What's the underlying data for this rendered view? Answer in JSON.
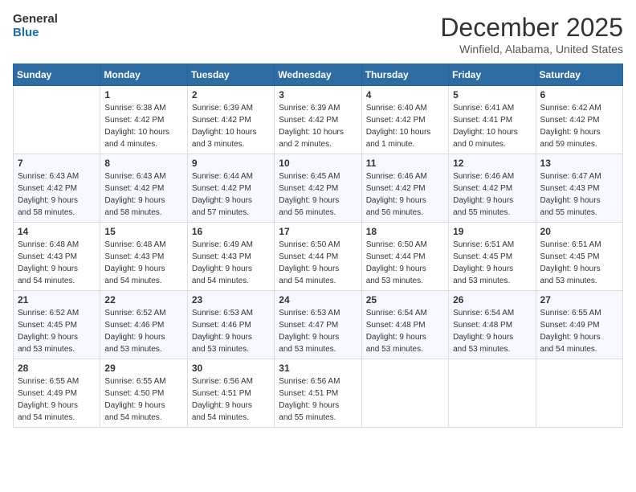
{
  "header": {
    "logo_line1": "General",
    "logo_line2": "Blue",
    "month_title": "December 2025",
    "location": "Winfield, Alabama, United States"
  },
  "weekdays": [
    "Sunday",
    "Monday",
    "Tuesday",
    "Wednesday",
    "Thursday",
    "Friday",
    "Saturday"
  ],
  "weeks": [
    [
      {
        "day": "",
        "info": ""
      },
      {
        "day": "1",
        "info": "Sunrise: 6:38 AM\nSunset: 4:42 PM\nDaylight: 10 hours\nand 4 minutes."
      },
      {
        "day": "2",
        "info": "Sunrise: 6:39 AM\nSunset: 4:42 PM\nDaylight: 10 hours\nand 3 minutes."
      },
      {
        "day": "3",
        "info": "Sunrise: 6:39 AM\nSunset: 4:42 PM\nDaylight: 10 hours\nand 2 minutes."
      },
      {
        "day": "4",
        "info": "Sunrise: 6:40 AM\nSunset: 4:42 PM\nDaylight: 10 hours\nand 1 minute."
      },
      {
        "day": "5",
        "info": "Sunrise: 6:41 AM\nSunset: 4:41 PM\nDaylight: 10 hours\nand 0 minutes."
      },
      {
        "day": "6",
        "info": "Sunrise: 6:42 AM\nSunset: 4:42 PM\nDaylight: 9 hours\nand 59 minutes."
      }
    ],
    [
      {
        "day": "7",
        "info": "Sunrise: 6:43 AM\nSunset: 4:42 PM\nDaylight: 9 hours\nand 58 minutes."
      },
      {
        "day": "8",
        "info": "Sunrise: 6:43 AM\nSunset: 4:42 PM\nDaylight: 9 hours\nand 58 minutes."
      },
      {
        "day": "9",
        "info": "Sunrise: 6:44 AM\nSunset: 4:42 PM\nDaylight: 9 hours\nand 57 minutes."
      },
      {
        "day": "10",
        "info": "Sunrise: 6:45 AM\nSunset: 4:42 PM\nDaylight: 9 hours\nand 56 minutes."
      },
      {
        "day": "11",
        "info": "Sunrise: 6:46 AM\nSunset: 4:42 PM\nDaylight: 9 hours\nand 56 minutes."
      },
      {
        "day": "12",
        "info": "Sunrise: 6:46 AM\nSunset: 4:42 PM\nDaylight: 9 hours\nand 55 minutes."
      },
      {
        "day": "13",
        "info": "Sunrise: 6:47 AM\nSunset: 4:43 PM\nDaylight: 9 hours\nand 55 minutes."
      }
    ],
    [
      {
        "day": "14",
        "info": "Sunrise: 6:48 AM\nSunset: 4:43 PM\nDaylight: 9 hours\nand 54 minutes."
      },
      {
        "day": "15",
        "info": "Sunrise: 6:48 AM\nSunset: 4:43 PM\nDaylight: 9 hours\nand 54 minutes."
      },
      {
        "day": "16",
        "info": "Sunrise: 6:49 AM\nSunset: 4:43 PM\nDaylight: 9 hours\nand 54 minutes."
      },
      {
        "day": "17",
        "info": "Sunrise: 6:50 AM\nSunset: 4:44 PM\nDaylight: 9 hours\nand 54 minutes."
      },
      {
        "day": "18",
        "info": "Sunrise: 6:50 AM\nSunset: 4:44 PM\nDaylight: 9 hours\nand 53 minutes."
      },
      {
        "day": "19",
        "info": "Sunrise: 6:51 AM\nSunset: 4:45 PM\nDaylight: 9 hours\nand 53 minutes."
      },
      {
        "day": "20",
        "info": "Sunrise: 6:51 AM\nSunset: 4:45 PM\nDaylight: 9 hours\nand 53 minutes."
      }
    ],
    [
      {
        "day": "21",
        "info": "Sunrise: 6:52 AM\nSunset: 4:45 PM\nDaylight: 9 hours\nand 53 minutes."
      },
      {
        "day": "22",
        "info": "Sunrise: 6:52 AM\nSunset: 4:46 PM\nDaylight: 9 hours\nand 53 minutes."
      },
      {
        "day": "23",
        "info": "Sunrise: 6:53 AM\nSunset: 4:46 PM\nDaylight: 9 hours\nand 53 minutes."
      },
      {
        "day": "24",
        "info": "Sunrise: 6:53 AM\nSunset: 4:47 PM\nDaylight: 9 hours\nand 53 minutes."
      },
      {
        "day": "25",
        "info": "Sunrise: 6:54 AM\nSunset: 4:48 PM\nDaylight: 9 hours\nand 53 minutes."
      },
      {
        "day": "26",
        "info": "Sunrise: 6:54 AM\nSunset: 4:48 PM\nDaylight: 9 hours\nand 53 minutes."
      },
      {
        "day": "27",
        "info": "Sunrise: 6:55 AM\nSunset: 4:49 PM\nDaylight: 9 hours\nand 54 minutes."
      }
    ],
    [
      {
        "day": "28",
        "info": "Sunrise: 6:55 AM\nSunset: 4:49 PM\nDaylight: 9 hours\nand 54 minutes."
      },
      {
        "day": "29",
        "info": "Sunrise: 6:55 AM\nSunset: 4:50 PM\nDaylight: 9 hours\nand 54 minutes."
      },
      {
        "day": "30",
        "info": "Sunrise: 6:56 AM\nSunset: 4:51 PM\nDaylight: 9 hours\nand 54 minutes."
      },
      {
        "day": "31",
        "info": "Sunrise: 6:56 AM\nSunset: 4:51 PM\nDaylight: 9 hours\nand 55 minutes."
      },
      {
        "day": "",
        "info": ""
      },
      {
        "day": "",
        "info": ""
      },
      {
        "day": "",
        "info": ""
      }
    ]
  ]
}
